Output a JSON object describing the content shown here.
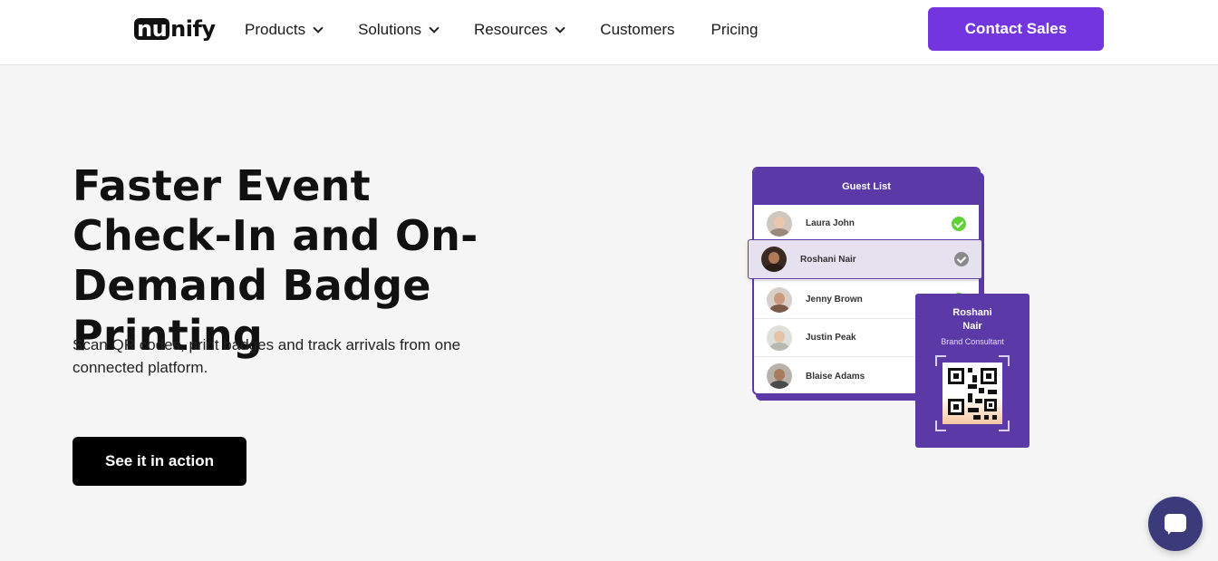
{
  "header": {
    "logo": {
      "part1": "nu",
      "part2": "nify"
    },
    "nav": [
      {
        "label": "Products",
        "dropdown": true
      },
      {
        "label": "Solutions",
        "dropdown": true
      },
      {
        "label": "Resources",
        "dropdown": true
      },
      {
        "label": "Customers",
        "dropdown": false
      },
      {
        "label": "Pricing",
        "dropdown": false
      }
    ],
    "contact_label": "Contact Sales"
  },
  "hero": {
    "title": "Faster Event Check-In and On-Demand Badge Printing",
    "subtitle": "Scan QR codes, print badges and track arrivals from one connected platform.",
    "cta_label": "See it in action"
  },
  "illustration": {
    "guest_list_title": "Guest List",
    "guests": [
      {
        "name": "Laura John",
        "status": "checked-in"
      },
      {
        "name": "Roshani Nair",
        "status": "selected"
      },
      {
        "name": "Jenny Brown",
        "status": "checked-in"
      },
      {
        "name": "Justin Peak",
        "status": "checked-in"
      },
      {
        "name": "Blaise Adams",
        "status": "checked-in"
      }
    ],
    "badge": {
      "name_line1": "Roshani",
      "name_line2": "Nair",
      "role": "Brand Consultant"
    }
  },
  "chat": {
    "icon": "chat-bubble-icon"
  },
  "colors": {
    "accent": "#7335e0",
    "brand_purple": "#5b3aa8",
    "check_green": "#5fd038",
    "check_gray": "#8a8a8a",
    "chat_bg": "#3b3a7a"
  }
}
